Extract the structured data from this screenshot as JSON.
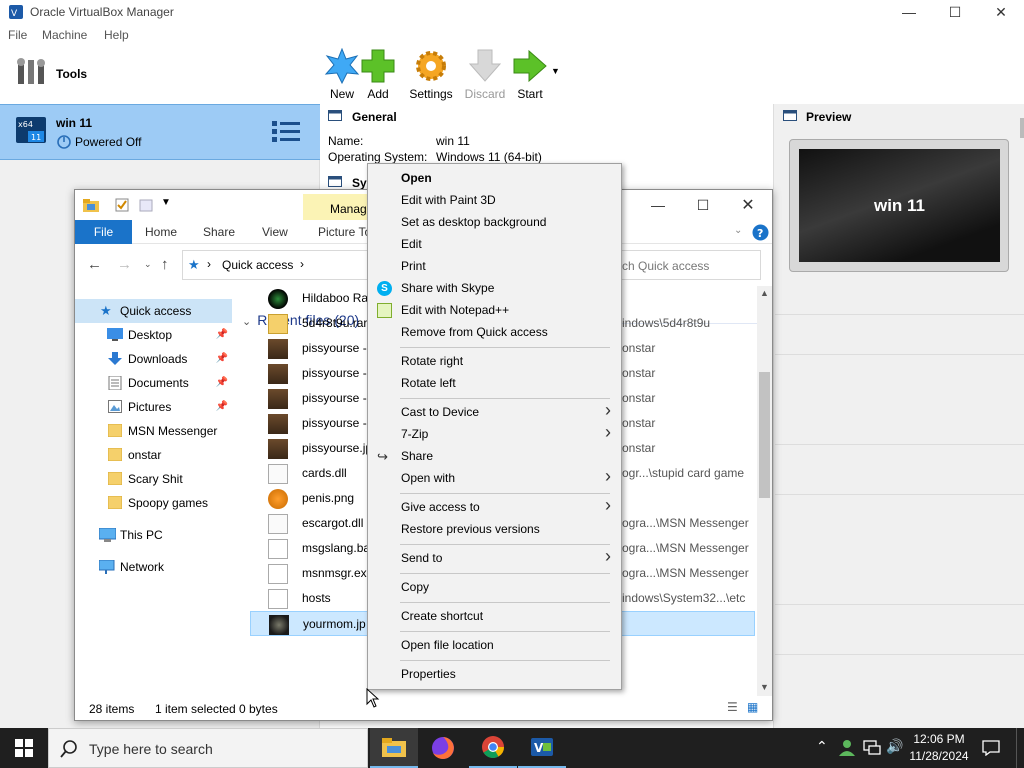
{
  "vbox": {
    "title": "Oracle VirtualBox Manager",
    "menu": [
      "File",
      "Machine",
      "Help"
    ],
    "tools_label": "Tools",
    "vm": {
      "name": "win 11",
      "state": "Powered Off"
    },
    "toolbar": {
      "new": "New",
      "add": "Add",
      "settings": "Settings",
      "discard": "Discard",
      "start": "Start"
    },
    "general": {
      "heading": "General",
      "name_label": "Name:",
      "name_value": "win 11",
      "os_label": "Operating System:",
      "os_value": "Windows 11 (64-bit)"
    },
    "system_heading_partial": "Sy",
    "preview": {
      "heading": "Preview",
      "screen_text": "win 11"
    }
  },
  "explorer": {
    "ribbon_contextual": "Manag",
    "tabs": [
      "File",
      "Home",
      "Share",
      "View",
      "Picture To"
    ],
    "address": "Quick access",
    "search_placeholder": "ch Quick access",
    "nav": {
      "quick_access": "Quick access",
      "pinned": [
        "Desktop",
        "Downloads",
        "Documents",
        "Pictures"
      ],
      "folders": [
        "MSN Messenger",
        "onstar",
        "Scary Shit",
        "Spoopy games"
      ],
      "this_pc": "This PC",
      "network": "Network"
    },
    "group_header": "Recent files (20)",
    "files": [
      {
        "name": "Hildaboo Ra",
        "path": ""
      },
      {
        "name": "5d4r8t9u.rar",
        "path": "indows\\5d4r8t9u"
      },
      {
        "name": "pissyourse -",
        "path": "onstar"
      },
      {
        "name": "pissyourse -",
        "path": "onstar"
      },
      {
        "name": "pissyourse -",
        "path": "onstar"
      },
      {
        "name": "pissyourse -",
        "path": "onstar"
      },
      {
        "name": "pissyourse.jp",
        "path": "onstar"
      },
      {
        "name": "cards.dll",
        "path": "ogr...\\stupid card game"
      },
      {
        "name": "penis.png",
        "path": ""
      },
      {
        "name": "escargot.dll",
        "path": "ogra...\\MSN Messenger"
      },
      {
        "name": "msgslang.ba",
        "path": "ogra...\\MSN Messenger"
      },
      {
        "name": "msnmsgr.ex",
        "path": "ogra...\\MSN Messenger"
      },
      {
        "name": "hosts",
        "path": "indows\\System32...\\etc"
      },
      {
        "name": "yourmom.jp",
        "path": ""
      }
    ],
    "status": {
      "items": "28 items",
      "selected": "1 item selected",
      "size": "0 bytes"
    }
  },
  "context_menu": {
    "items": [
      {
        "label": "Open",
        "bold": true
      },
      {
        "label": "Edit with Paint 3D"
      },
      {
        "label": "Set as desktop background"
      },
      {
        "label": "Edit"
      },
      {
        "label": "Print"
      },
      {
        "label": "Share with Skype"
      },
      {
        "label": "Edit with Notepad++"
      },
      {
        "label": "Remove from Quick access"
      },
      {
        "label": "Rotate right"
      },
      {
        "label": "Rotate left"
      },
      {
        "label": "Cast to Device"
      },
      {
        "label": "7-Zip"
      },
      {
        "label": "Share"
      },
      {
        "label": "Open with"
      },
      {
        "label": "Give access to"
      },
      {
        "label": "Restore previous versions"
      },
      {
        "label": "Send to"
      },
      {
        "label": "Copy"
      },
      {
        "label": "Create shortcut"
      },
      {
        "label": "Open file location"
      },
      {
        "label": "Properties"
      }
    ]
  },
  "taskbar": {
    "search_placeholder": "Type here to search",
    "time": "12:06 PM",
    "date": "11/28/2024"
  },
  "colors": {
    "accent": "#0078d7",
    "vm_selected": "#9dcbf5",
    "taskbar": "#1f1f1f"
  }
}
